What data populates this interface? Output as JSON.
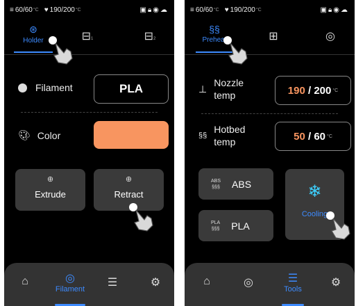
{
  "status": {
    "bed": "60/60",
    "nozzle": "190/200",
    "unit": "°C"
  },
  "panel1": {
    "tabs": [
      {
        "label": "Holder",
        "icon": "spool-icon"
      },
      {
        "sub": "1",
        "icon": "extruder-icon"
      },
      {
        "sub": "2",
        "icon": "extruder-icon"
      }
    ],
    "filament": {
      "label": "Filament",
      "value": "PLA"
    },
    "color": {
      "label": "Color",
      "swatch": "#F89560"
    },
    "buttons": [
      {
        "label": "Extrude"
      },
      {
        "label": "Retract"
      }
    ],
    "nav": {
      "active_label": "Filament"
    }
  },
  "panel2": {
    "tabs": [
      {
        "label": "Preheat",
        "icon": "heat-icon"
      },
      {
        "icon": "fan-block-icon"
      },
      {
        "icon": "target-icon"
      }
    ],
    "nozzle": {
      "label_line1": "Nozzle",
      "label_line2": "temp",
      "current": "190",
      "sep": " / ",
      "target": "200",
      "unit": "°C"
    },
    "hotbed": {
      "label_line1": "Hotbed",
      "label_line2": "temp",
      "current": "50",
      "sep": " / ",
      "target": "60",
      "unit": "°C"
    },
    "presets": [
      {
        "icon_text": "ABS",
        "label": "ABS"
      },
      {
        "icon_text": "PLA",
        "label": "PLA"
      }
    ],
    "cooling": {
      "label": "Cooling"
    },
    "nav": {
      "active_label": "Tools"
    }
  },
  "colors": {
    "accent": "#3D8BFF",
    "current_temp": "#F89560",
    "swatch": "#F89560"
  }
}
